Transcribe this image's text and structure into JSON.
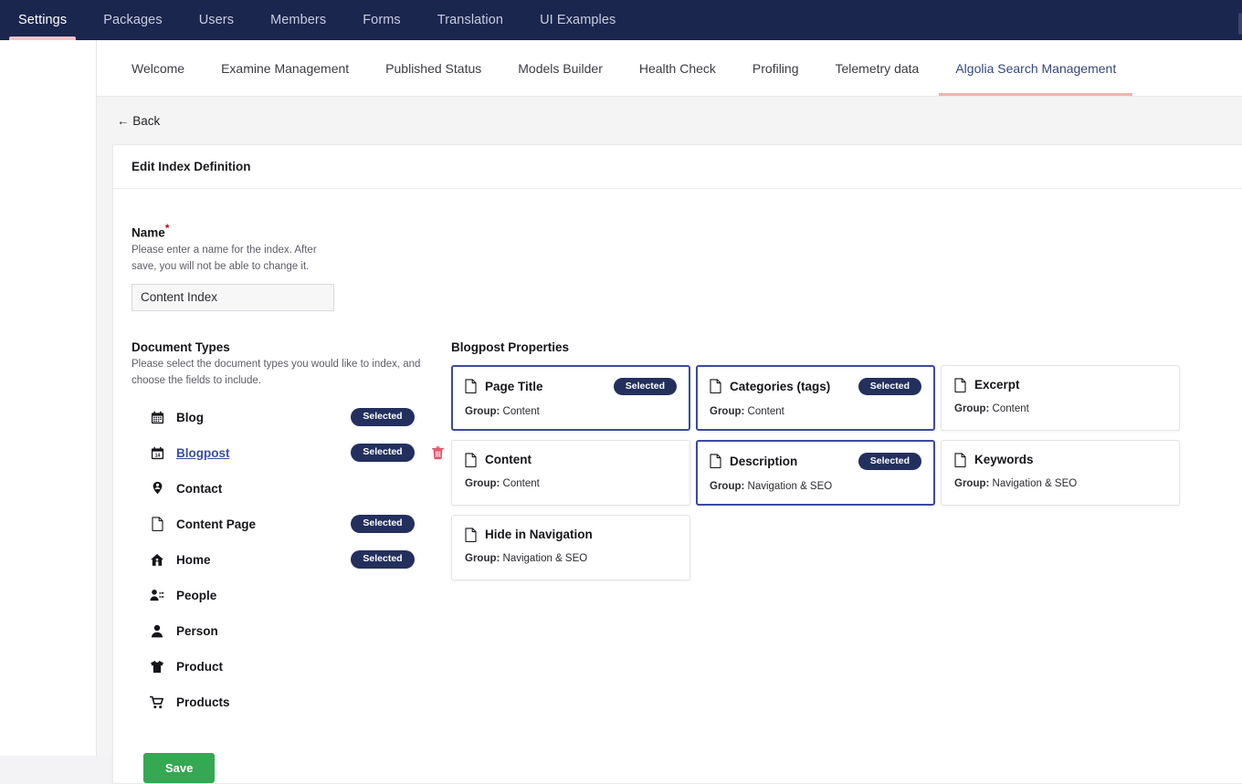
{
  "topnav": {
    "items": [
      {
        "label": "Settings",
        "active": true
      },
      {
        "label": "Packages",
        "active": false
      },
      {
        "label": "Users",
        "active": false
      },
      {
        "label": "Members",
        "active": false
      },
      {
        "label": "Forms",
        "active": false
      },
      {
        "label": "Translation",
        "active": false
      },
      {
        "label": "UI Examples",
        "active": false
      }
    ]
  },
  "subtabs": {
    "items": [
      {
        "label": "Welcome",
        "active": false
      },
      {
        "label": "Examine Management",
        "active": false
      },
      {
        "label": "Published Status",
        "active": false
      },
      {
        "label": "Models Builder",
        "active": false
      },
      {
        "label": "Health Check",
        "active": false
      },
      {
        "label": "Profiling",
        "active": false
      },
      {
        "label": "Telemetry data",
        "active": false
      },
      {
        "label": "Algolia Search Management",
        "active": true
      }
    ]
  },
  "back": {
    "label": "← Back"
  },
  "panel": {
    "title": "Edit Index Definition"
  },
  "name_field": {
    "label": "Name",
    "required_mark": "*",
    "help": "Please enter a name for the index. After save, you will not be able to change it.",
    "value": "Content Index",
    "placeholder": "Content Index"
  },
  "document_types": {
    "title": "Document Types",
    "help": "Please select the document types you would like to index, and choose the fields to include.",
    "selected_label": "Selected",
    "items": [
      {
        "label": "Blog",
        "icon": "calendar-icon",
        "selected": true,
        "link": false,
        "deletable": false
      },
      {
        "label": "Blogpost",
        "icon": "calendar-14-icon",
        "selected": true,
        "link": true,
        "deletable": true
      },
      {
        "label": "Contact",
        "icon": "map-pin-user-icon",
        "selected": false,
        "link": false,
        "deletable": false
      },
      {
        "label": "Content Page",
        "icon": "document-icon",
        "selected": true,
        "link": false,
        "deletable": false
      },
      {
        "label": "Home",
        "icon": "home-icon",
        "selected": true,
        "link": false,
        "deletable": false
      },
      {
        "label": "People",
        "icon": "people-icon",
        "selected": false,
        "link": false,
        "deletable": false
      },
      {
        "label": "Person",
        "icon": "person-icon",
        "selected": false,
        "link": false,
        "deletable": false
      },
      {
        "label": "Product",
        "icon": "shirt-icon",
        "selected": false,
        "link": false,
        "deletable": false
      },
      {
        "label": "Products",
        "icon": "cart-icon",
        "selected": false,
        "link": false,
        "deletable": false
      }
    ]
  },
  "properties": {
    "title": "Blogpost Properties",
    "group_label": "Group:",
    "selected_label": "Selected",
    "items": [
      {
        "label": "Page Title",
        "group": "Content",
        "selected": true,
        "icon": "document-icon"
      },
      {
        "label": "Categories (tags)",
        "group": "Content",
        "selected": true,
        "icon": "document-icon"
      },
      {
        "label": "Excerpt",
        "group": "Content",
        "selected": false,
        "icon": "document-icon"
      },
      {
        "label": "Content",
        "group": "Content",
        "selected": false,
        "icon": "document-icon"
      },
      {
        "label": "Description",
        "group": "Navigation & SEO",
        "selected": true,
        "icon": "document-icon"
      },
      {
        "label": "Keywords",
        "group": "Navigation & SEO",
        "selected": false,
        "icon": "document-icon"
      },
      {
        "label": "Hide in Navigation",
        "group": "Navigation & SEO",
        "selected": false,
        "icon": "document-icon"
      }
    ]
  },
  "save": {
    "label": "Save"
  },
  "colors": {
    "topbar": "#1b264f",
    "accent_underline": "#f0b4ac",
    "badge": "#23305e",
    "selected_border": "#3b4a9e",
    "save": "#34a853",
    "delete": "#e0566b",
    "link": "#3c4fa0"
  }
}
